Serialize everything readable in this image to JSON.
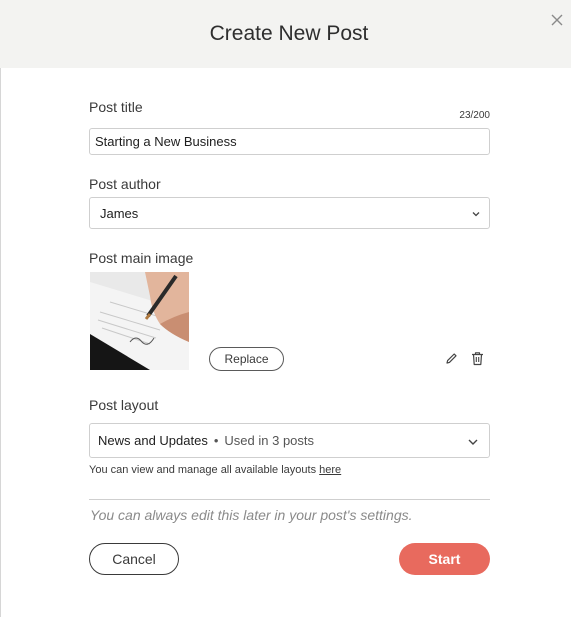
{
  "dialog": {
    "title": "Create New Post"
  },
  "form": {
    "post_title": {
      "label": "Post title",
      "value": "Starting a New Business",
      "counter": "23/200"
    },
    "post_author": {
      "label": "Post author",
      "value": "James"
    },
    "post_image": {
      "label": "Post main image",
      "replace_label": "Replace"
    },
    "post_layout": {
      "label": "Post layout",
      "value": "News and Updates",
      "separator": "•",
      "usage": "Used in 3 posts",
      "help_text": "You can view and manage all available layouts",
      "help_link": "here"
    },
    "note": "You can always edit this later in your post's settings."
  },
  "actions": {
    "cancel_label": "Cancel",
    "start_label": "Start"
  },
  "colors": {
    "accent": "#e86a5e",
    "header_bg": "#f3f3f1"
  },
  "icons": [
    "close-icon",
    "chevron-down-icon",
    "edit-icon",
    "trash-icon"
  ]
}
